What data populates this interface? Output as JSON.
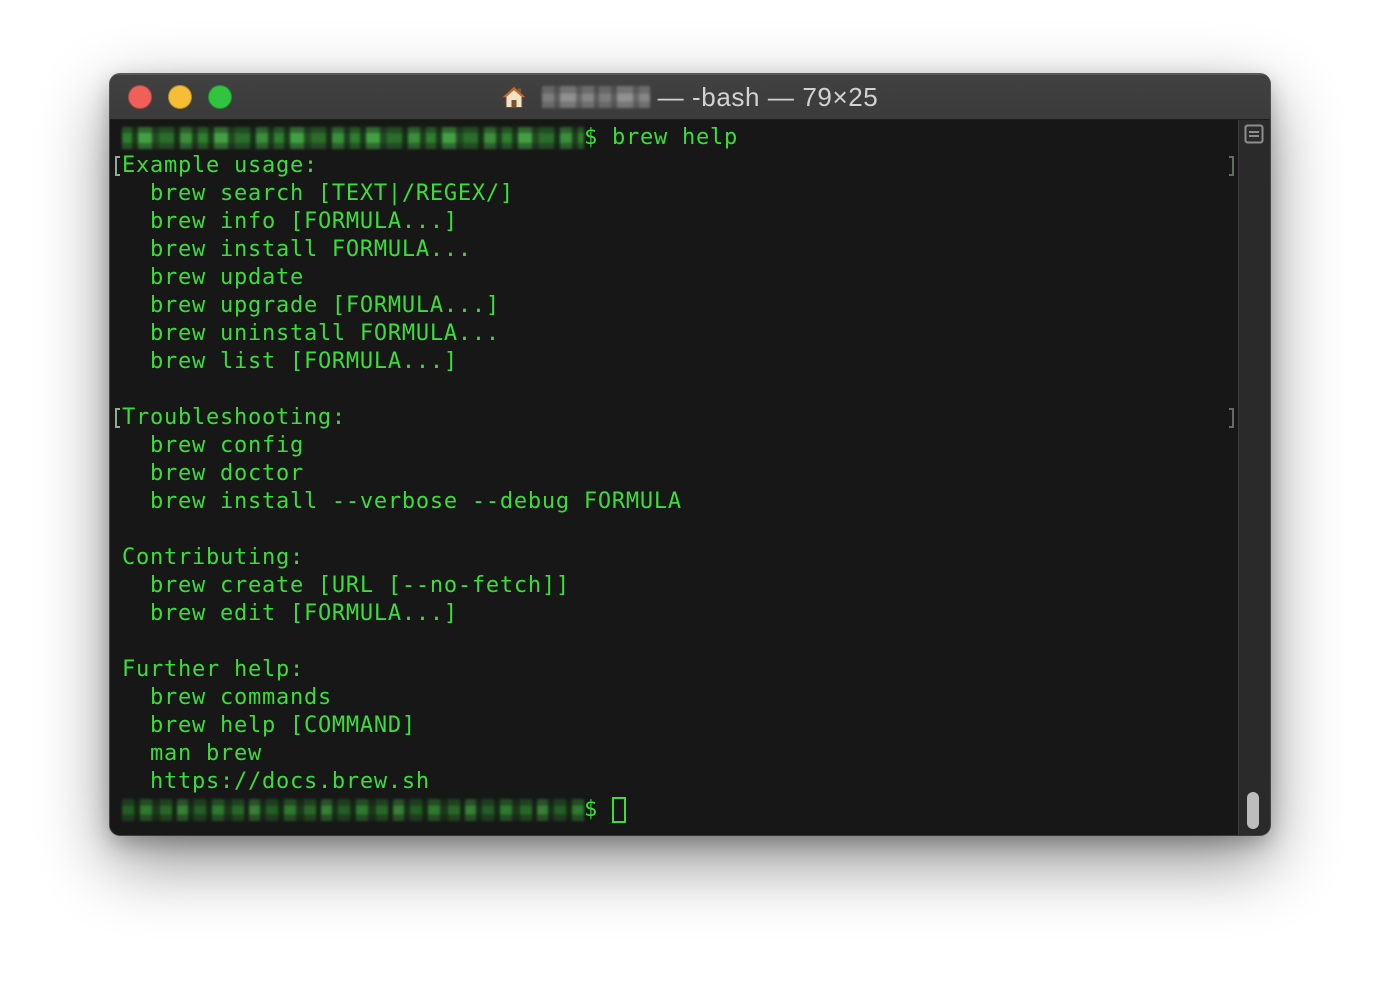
{
  "colors": {
    "terminal_text": "#38df38",
    "terminal_background": "#171717",
    "title_bar": "#3b3b3b",
    "title_text": "#d2d2d2",
    "close_button": "#f0605a",
    "minimize_button": "#f6be35",
    "zoom_button": "#30c440"
  },
  "window": {
    "title_icon": "house-icon",
    "title_text": "— -bash — 79×25"
  },
  "terminal": {
    "prompt_symbol": "$",
    "command": "brew help",
    "help_sections": [
      {
        "heading": "Example usage:",
        "items": [
          "brew search [TEXT|/REGEX/]",
          "brew info [FORMULA...]",
          "brew install FORMULA...",
          "brew update",
          "brew upgrade [FORMULA...]",
          "brew uninstall FORMULA...",
          "brew list [FORMULA...]"
        ]
      },
      {
        "heading": "Troubleshooting:",
        "items": [
          "brew config",
          "brew doctor",
          "brew install --verbose --debug FORMULA"
        ]
      },
      {
        "heading": "Contributing:",
        "items": [
          "brew create [URL [--no-fetch]]",
          "brew edit [FORMULA...]"
        ]
      },
      {
        "heading": "Further help:",
        "items": [
          "brew commands",
          "brew help [COMMAND]",
          "man brew",
          "https://docs.brew.sh"
        ]
      }
    ]
  },
  "scrollbar": {
    "icon": "split-pane-icon",
    "scroll_position": 1
  }
}
